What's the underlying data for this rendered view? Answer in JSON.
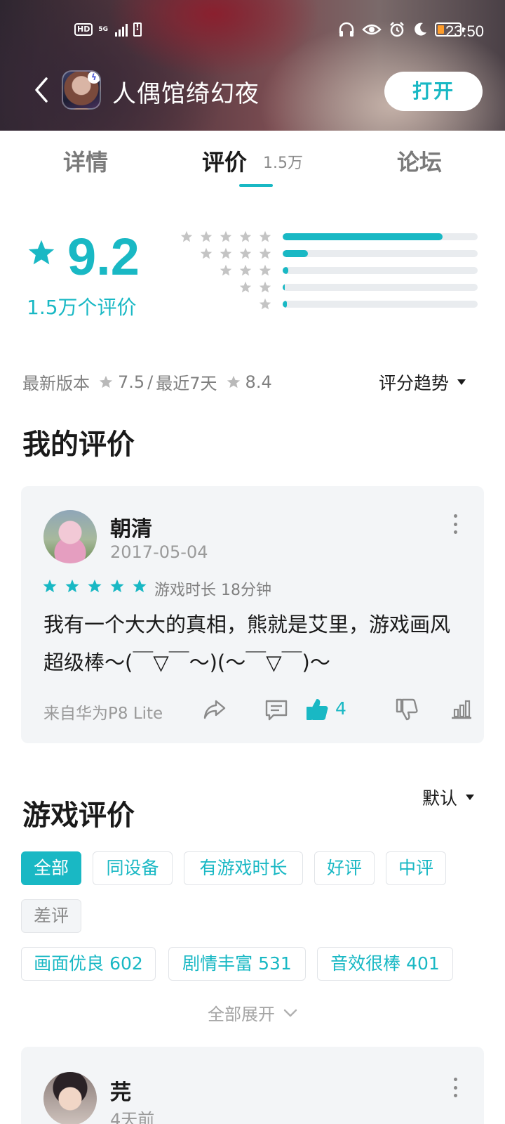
{
  "status_bar": {
    "hd": "HD",
    "network": "5G",
    "time": "23:50"
  },
  "app": {
    "title": "人偶馆绮幻夜",
    "open_label": "打开"
  },
  "tabs": [
    {
      "label": "详情",
      "active": false
    },
    {
      "label": "评价",
      "count": "1.5万",
      "active": true
    },
    {
      "label": "论坛",
      "active": false
    }
  ],
  "rating": {
    "score": "9.2",
    "count_label": "1.5万个评价",
    "distribution": [
      {
        "stars": 5,
        "fraction": 0.82
      },
      {
        "stars": 4,
        "fraction": 0.13
      },
      {
        "stars": 3,
        "fraction": 0.03
      },
      {
        "stars": 2,
        "fraction": 0.01
      },
      {
        "stars": 1,
        "fraction": 0.02
      }
    ],
    "latest_version_label": "最新版本",
    "latest_version_score": "7.5",
    "separator": "/",
    "recent_label": "最近7天",
    "recent_score": "8.4",
    "trend_label": "评分趋势"
  },
  "my_review_section": {
    "title": "我的评价",
    "review": {
      "user": "朝清",
      "date": "2017-05-04",
      "stars": 5,
      "playtime": "游戏时长 18分钟",
      "text": "我有一个大大的真相，熊就是艾里，游戏画风超级棒～(￣▽￣～)(～￣▽￣)～",
      "device": "来自华为P8 Lite",
      "likes": "4"
    }
  },
  "game_reviews_section": {
    "title": "游戏评价",
    "sort_label": "默认",
    "filters": [
      "全部",
      "同设备",
      "有游戏时长",
      "好评",
      "中评",
      "差评"
    ],
    "tags": [
      "画面优良 602",
      "剧情丰富 531",
      "音效很棒 401"
    ],
    "expand_label": "全部展开",
    "first_review": {
      "user": "芫",
      "date": "4天前"
    }
  },
  "colors": {
    "accent": "#19b8c4",
    "muted_text": "#9a9a9a",
    "card_bg": "#f3f5f7",
    "star_grey": "#c4c4c4"
  },
  "icons": [
    "back-arrow-icon",
    "star-icon",
    "share-icon",
    "comment-icon",
    "thumbs-up-icon",
    "thumbs-down-icon",
    "stats-icon",
    "more-icon",
    "caret-down-icon",
    "chevron-down-icon"
  ]
}
